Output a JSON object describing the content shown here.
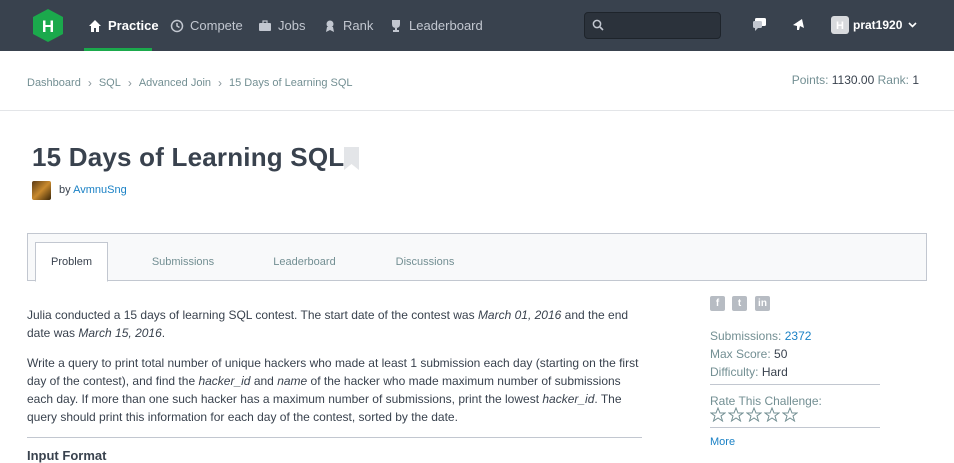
{
  "nav": {
    "items": [
      {
        "label": "Practice",
        "icon": "home-icon",
        "active": true
      },
      {
        "label": "Compete",
        "icon": "clock-icon"
      },
      {
        "label": "Jobs",
        "icon": "briefcase-icon"
      },
      {
        "label": "Rank",
        "icon": "medal-icon"
      },
      {
        "label": "Leaderboard",
        "icon": "trophy-icon"
      }
    ],
    "search_placeholder": "",
    "username": "prat1920",
    "accent": "#1ba94c",
    "bg": "#39424e"
  },
  "breadcrumb": [
    "Dashboard",
    "SQL",
    "Advanced Join",
    "15 Days of Learning SQL"
  ],
  "stats": {
    "points_label": "Points:",
    "points": "1130.00",
    "rank_label": "Rank:",
    "rank": "1"
  },
  "challenge": {
    "title": "15 Days of Learning SQL",
    "by": "by",
    "author": "AvmnuSng"
  },
  "tabs": [
    "Problem",
    "Submissions",
    "Leaderboard",
    "Discussions"
  ],
  "problem": {
    "p1_a": "Julia conducted a 15 days of learning SQL contest. The start date of the contest was ",
    "p1_b": "March 01, 2016",
    "p1_c": " and the end date was ",
    "p1_d": "March 15, 2016",
    "p1_e": ".",
    "p2_a": "Write a query to print total number of unique hackers who made at least 1 submission each day (starting on the first day of the contest), and find the ",
    "p2_b": "hacker_id",
    "p2_c": " and ",
    "p2_d": "name",
    "p2_e": " of the hacker who made maximum number of submissions each day. If more than one such hacker has a maximum number of submissions, print the lowest ",
    "p2_f": "hacker_id",
    "p2_g": ". The query should print this information for each day of the contest, sorted by the date.",
    "next_heading": "Input Format"
  },
  "sidebar": {
    "submissions_label": "Submissions:",
    "submissions": "2372",
    "max_score_label": "Max Score:",
    "max_score": "50",
    "difficulty_label": "Difficulty:",
    "difficulty": "Hard",
    "rate_label": "Rate This Challenge:",
    "more": "More",
    "social": [
      "facebook-icon",
      "twitter-icon",
      "linkedin-icon"
    ]
  }
}
